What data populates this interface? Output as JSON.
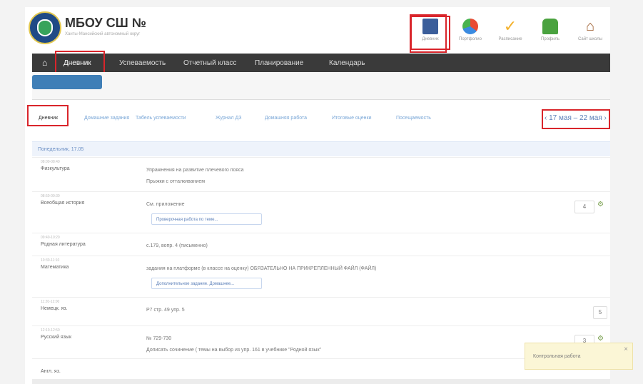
{
  "header": {
    "school_title": "МБОУ СШ №",
    "school_subtitle": "Ханты-Мансийский автономный округ",
    "apps": [
      {
        "label": "Дневник",
        "icon": "diary-icon",
        "active": true
      },
      {
        "label": "Портфолио",
        "icon": "chart-icon"
      },
      {
        "label": "Расписание",
        "icon": "check-icon"
      },
      {
        "label": "Профиль",
        "icon": "person-icon"
      },
      {
        "label": "Сайт школы",
        "icon": "home-icon"
      }
    ]
  },
  "nav": {
    "items": [
      {
        "label": "Дневник"
      },
      {
        "label": "Успеваемость"
      },
      {
        "label": "Отчетный класс"
      },
      {
        "label": "Планирование"
      },
      {
        "label": "Календарь"
      }
    ]
  },
  "tabs": [
    {
      "label": "Дневник"
    },
    {
      "label": "Домашние задания"
    },
    {
      "label": "Табель успеваемости"
    },
    {
      "label": "Журнал ДЗ"
    },
    {
      "label": "Домашняя работа"
    },
    {
      "label": "Итоговые оценки"
    },
    {
      "label": "Посещаемость"
    }
  ],
  "week": {
    "prev": "‹",
    "label": "17 мая – 22 мая",
    "next": "›"
  },
  "day": {
    "title": "Понедельник, 17.05"
  },
  "lessons": [
    {
      "time": "08:00-08:40",
      "subject": "Физкультура",
      "homework": [
        "Упражнения на развитие плечевого пояса",
        "Прыжки с отталкиванием"
      ]
    },
    {
      "time": "08:50-09:30",
      "subject": "Всеобщая история",
      "homework": [
        "См. приложение"
      ],
      "attachment": "Проверочная работа по теме...",
      "grade": "4"
    },
    {
      "time": "09:40-10:20",
      "subject": "Родная литература",
      "homework": [
        "с.179, вопр. 4 (письменно)"
      ]
    },
    {
      "time": "10:30-11:10",
      "subject": "Математика",
      "homework": [
        "задания на платформе (в классе на оценку) ОБЯЗАТЕЛЬНО НА ПРИКРЕПЛЕННЫЙ ФАЙЛ (ФАЙЛ)"
      ],
      "attachment": "Дополнительное задание. Домашнее..."
    },
    {
      "time": "11:20-12:00",
      "subject": "Немецк. яз.",
      "homework": [
        "Р7 стр. 49 упр. 5"
      ],
      "grade": "5"
    },
    {
      "time": "12:10-12:50",
      "subject": "Русский язык",
      "homework": [
        "№ 729-730",
        "Дописать сочинение ( темы на выбор из упр. 161 в учебнике \"Родной язык\""
      ],
      "grade": "3"
    },
    {
      "time": "",
      "subject": "Англ. яз."
    }
  ],
  "toast": {
    "text": "Контрольная работа",
    "close": "×"
  }
}
